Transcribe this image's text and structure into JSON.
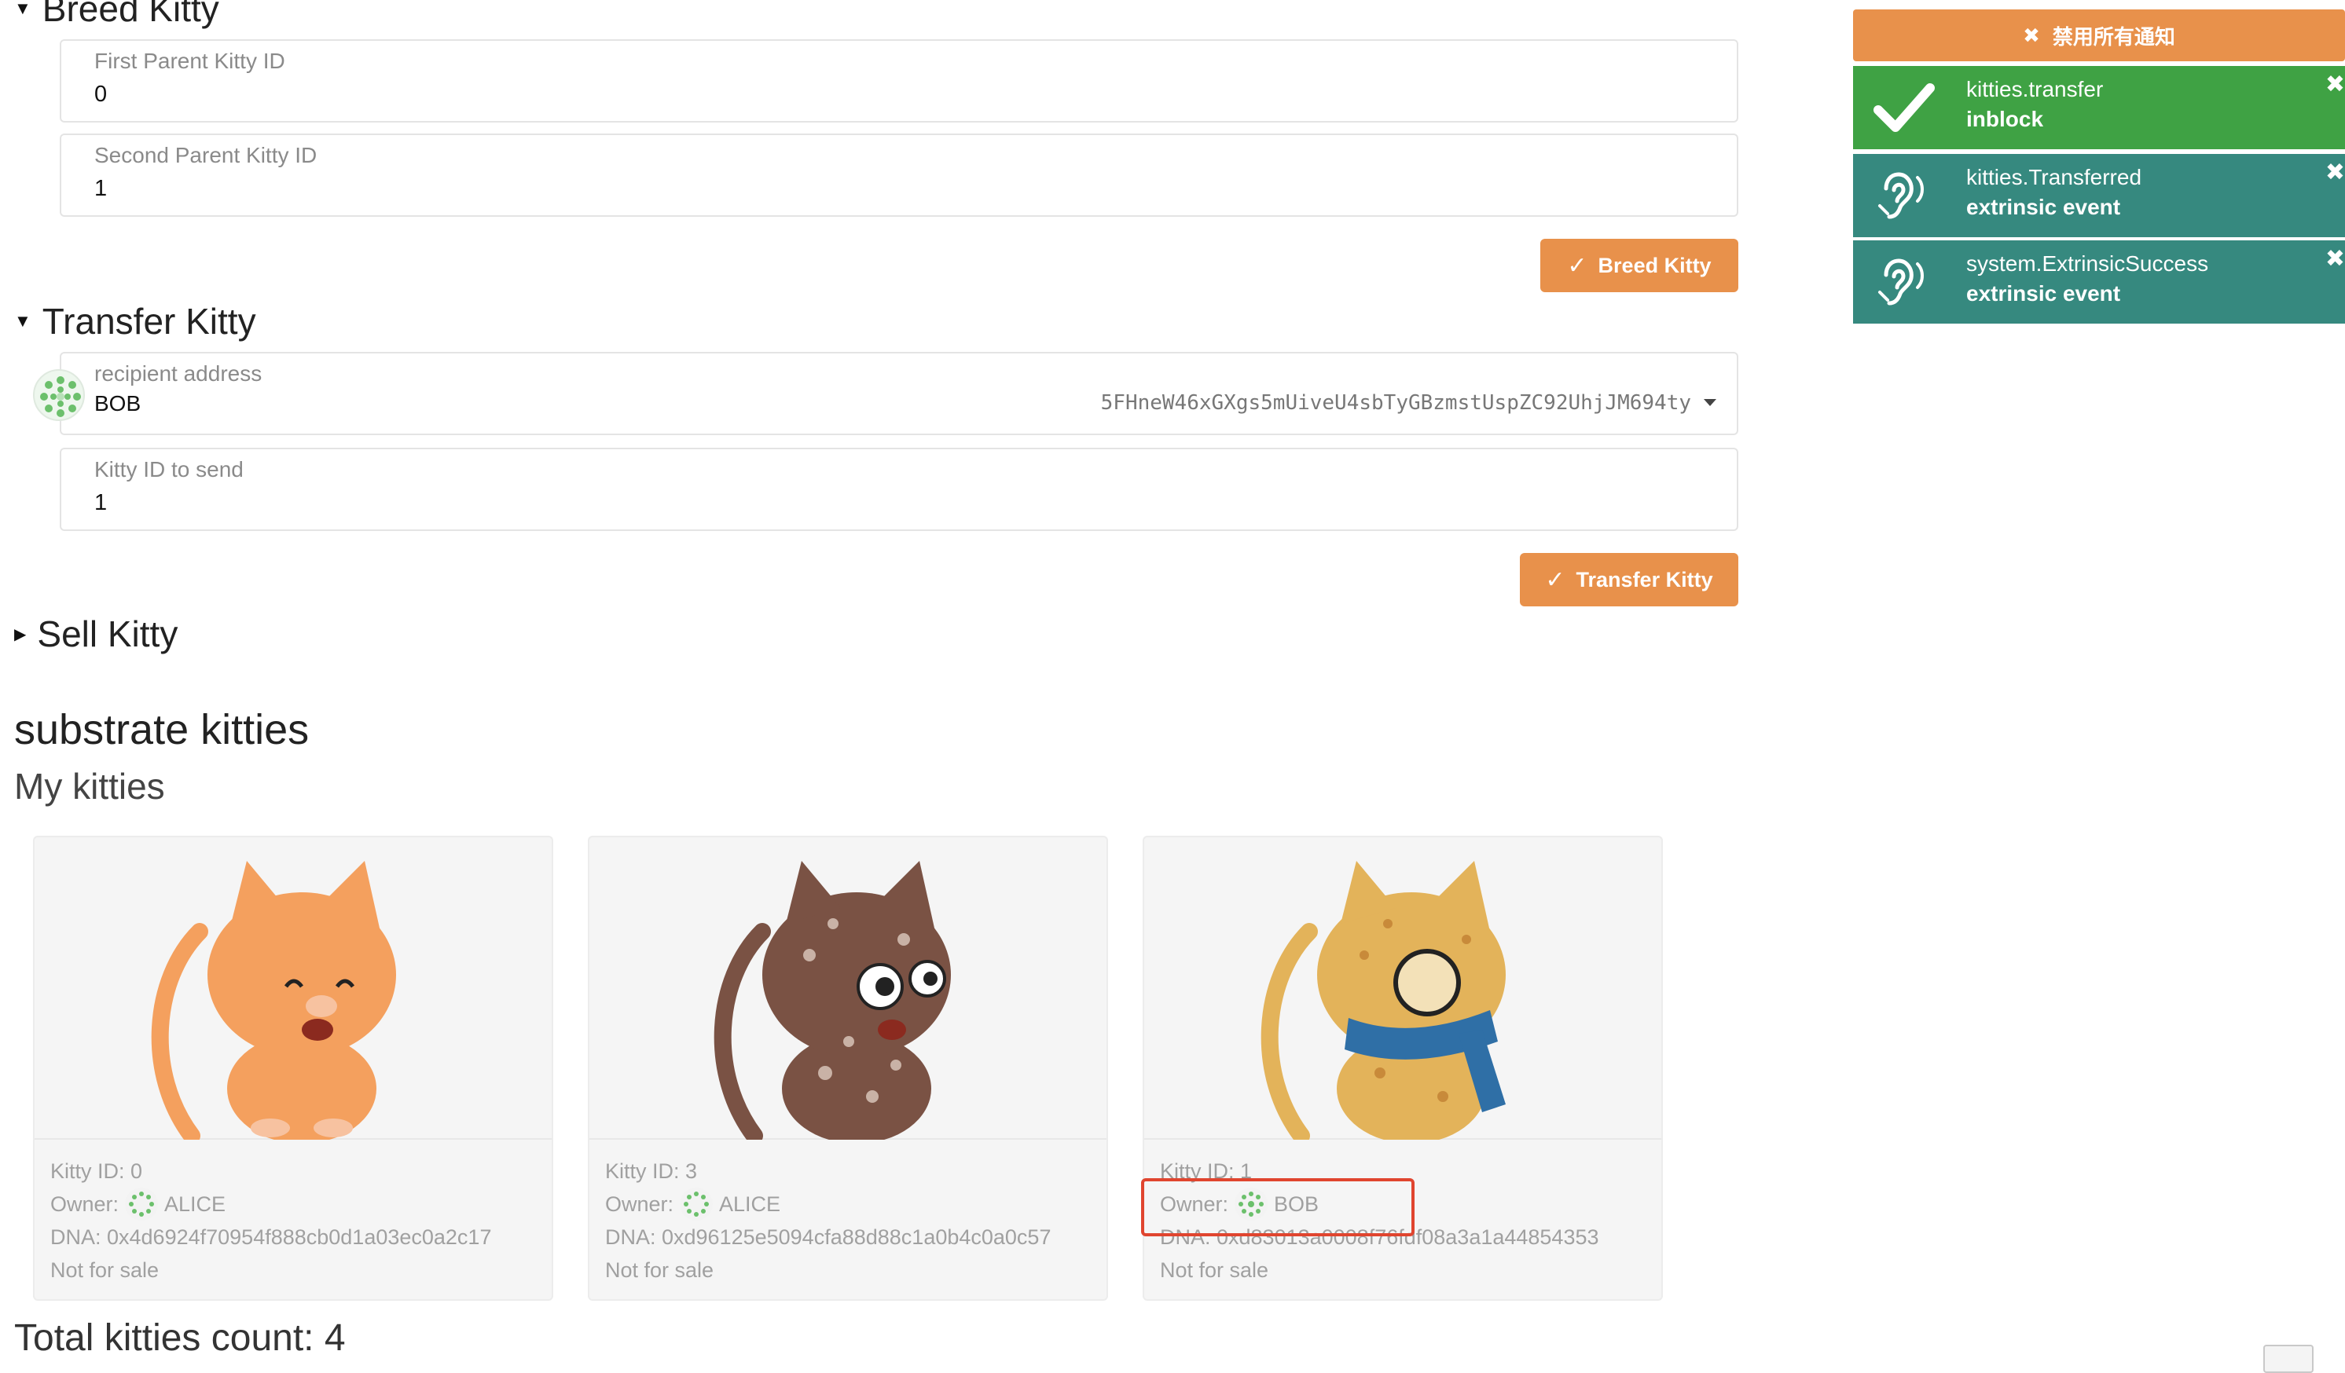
{
  "breed": {
    "section_title": "Breed Kitty",
    "first_parent_label": "First Parent Kitty ID",
    "first_parent_value": "0",
    "second_parent_label": "Second Parent Kitty ID",
    "second_parent_value": "1",
    "button_label": "Breed Kitty"
  },
  "transfer": {
    "section_title": "Transfer Kitty",
    "recipient_label": "recipient address",
    "recipient_name": "BOB",
    "recipient_address": "5FHneW46xGXgs5mUiveU4sbTyGBzmstUspZC92UhjJM694ty",
    "kitty_label": "Kitty ID to send",
    "kitty_value": "1",
    "button_label": "Transfer Kitty"
  },
  "sell": {
    "section_title": "Sell Kitty"
  },
  "main": {
    "title": "substrate kitties",
    "subtitle": "My kitties",
    "total": "Total kitties count: 4"
  },
  "kitties": [
    {
      "id_text": "Kitty ID: 0",
      "owner_label": "Owner:",
      "owner_name": "ALICE",
      "dna": "DNA: 0x4d6924f70954f888cb0d1a03ec0a2c17",
      "status": "Not for sale",
      "body_color": "#f4a05e"
    },
    {
      "id_text": "Kitty ID: 3",
      "owner_label": "Owner:",
      "owner_name": "ALICE",
      "dna": "DNA: 0xd96125e5094cfa88d88c1a0b4c0a0c57",
      "status": "Not for sale",
      "body_color": "#7a5244"
    },
    {
      "id_text": "Kitty ID: 1",
      "owner_label": "Owner:",
      "owner_name": "BOB",
      "dna": "DNA: 0xd83013a0008f76fdf08a3a1a44854353",
      "status": "Not for sale",
      "body_color": "#e3b35a"
    }
  ],
  "notifications": {
    "dismiss_all_label": "禁用所有通知",
    "items": [
      {
        "title": "kitties.transfer",
        "subtitle": "inblock",
        "kind": "success"
      },
      {
        "title": "kitties.Transferred",
        "subtitle": "extrinsic event",
        "kind": "event"
      },
      {
        "title": "system.ExtrinsicSuccess",
        "subtitle": "extrinsic event",
        "kind": "event"
      }
    ]
  },
  "colors": {
    "accent": "#e8914b",
    "success": "#3fa244",
    "event": "#36897f",
    "highlight": "#e0452f"
  }
}
